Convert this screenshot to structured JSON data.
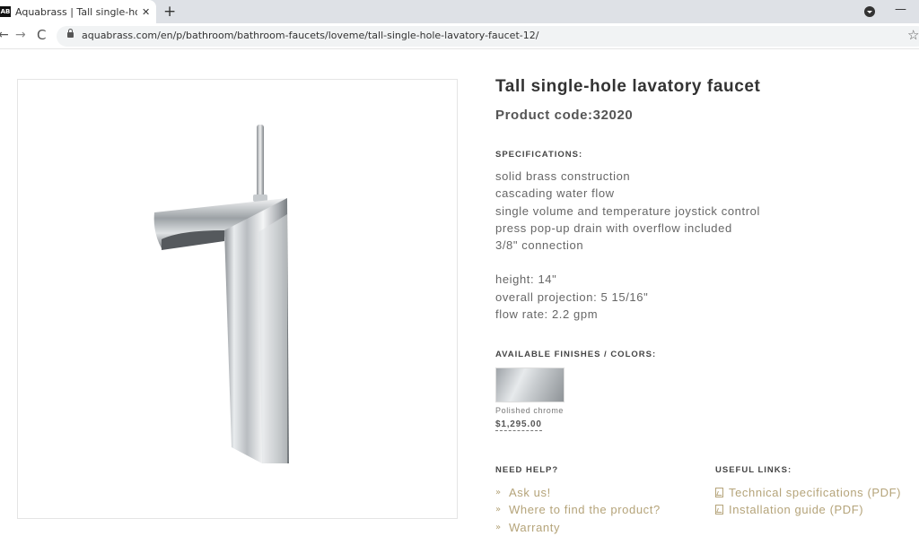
{
  "browser": {
    "tab": {
      "favicon_text": "AB",
      "title": "Aquabrass | Tall single-hole lavat",
      "close": "✕"
    },
    "new_tab": "+",
    "minimize": "—",
    "back": "←",
    "forward": "→",
    "reload": "C",
    "url": "aquabrass.com/en/p/bathroom/bathroom-faucets/loveme/tall-single-hole-lavatory-faucet-12/",
    "star": "☆"
  },
  "product": {
    "title": "Tall single-hole lavatory faucet",
    "code": "Product code:32020",
    "specifications_heading": "SPECIFICATIONS:",
    "features": [
      "solid brass construction",
      "cascading water flow",
      "single volume and temperature joystick control",
      "press pop-up drain with overflow included",
      "3/8\" connection"
    ],
    "dimensions": [
      "height: 14\"",
      "overall projection: 5 15/16\"",
      "flow rate: 2.2 gpm"
    ],
    "finishes_heading": "AVAILABLE FINISHES / COLORS:",
    "finish": {
      "name": "Polished chrome",
      "price": "$1,295.00"
    }
  },
  "help": {
    "heading": "NEED HELP?",
    "links": [
      "Ask us!",
      "Where to find the product?",
      "Warranty"
    ]
  },
  "useful": {
    "heading": "USEFUL LINKS:",
    "links": [
      "Technical specifications (PDF)",
      "Installation guide (PDF)"
    ]
  },
  "icons": {
    "chevron": "»",
    "pdf": "pdf-icon",
    "lock": "lock-icon"
  },
  "colors": {
    "link_gold": "#b5a47a",
    "heading": "#444444",
    "body_text": "#666666",
    "tabbar": "#dee1e6"
  }
}
